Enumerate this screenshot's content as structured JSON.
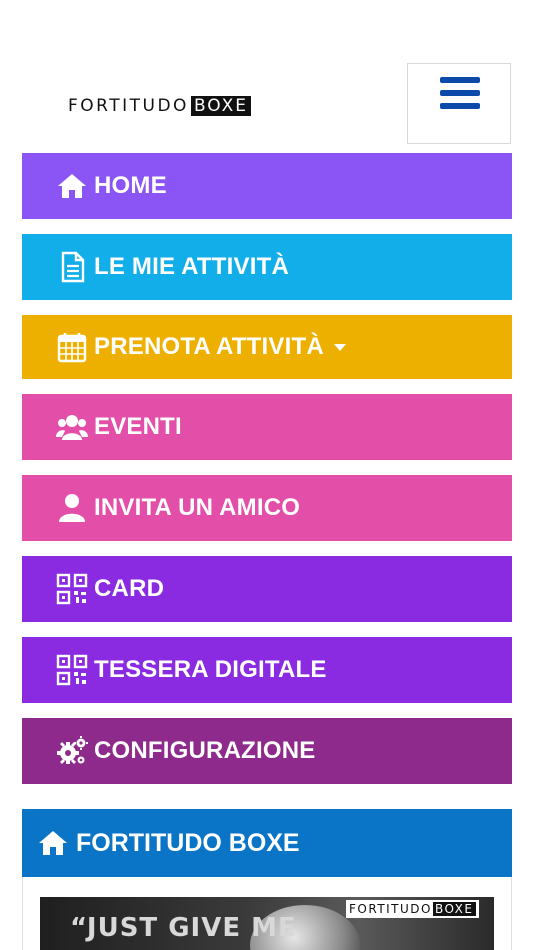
{
  "header": {
    "logo_part1": "FORTITUDO",
    "logo_part2": "BOXE",
    "menu_icon": "hamburger-icon",
    "accent": "#0b4aa8"
  },
  "nav": {
    "items": [
      {
        "label": "HOME",
        "icon": "home-icon",
        "color": "#8b55f5"
      },
      {
        "label": "LE MIE ATTIVITÀ",
        "icon": "document-icon",
        "color": "#12aee9"
      },
      {
        "label": "PRENOTA ATTIVITÀ",
        "icon": "calendar-icon",
        "color": "#eeb000",
        "has_dropdown": true
      },
      {
        "label": "EVENTI",
        "icon": "users-icon",
        "color": "#e24ea8"
      },
      {
        "label": "INVITA UN AMICO",
        "icon": "user-icon",
        "color": "#e24ea8"
      },
      {
        "label": "CARD",
        "icon": "qrcode-icon",
        "color": "#8a2be2"
      },
      {
        "label": "TESSERA DIGITALE",
        "icon": "qrcode-icon",
        "color": "#8a2be2"
      },
      {
        "label": "CONFIGURAZIONE",
        "icon": "gears-icon",
        "color": "#8e2a8c"
      }
    ]
  },
  "panel": {
    "title": "FORTITUDO BOXE",
    "icon": "home-icon",
    "color": "#0a74c6",
    "banner": {
      "quote": "“JUST GIVE ME",
      "logo_part1": "FORTITUDO",
      "logo_part2": "BOXE"
    }
  }
}
